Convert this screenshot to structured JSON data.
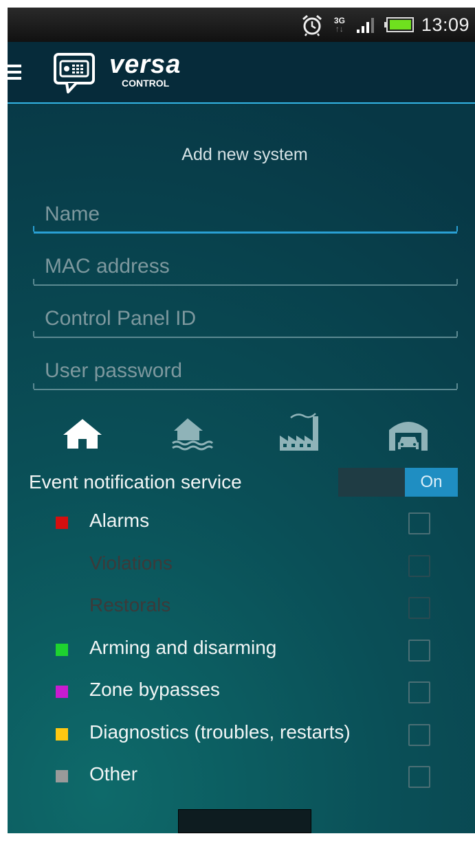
{
  "status_bar": {
    "time": "13:09",
    "network": "3G",
    "icons": [
      "alarm-clock-icon",
      "network-3g-icon",
      "signal-icon",
      "battery-icon"
    ]
  },
  "app_bar": {
    "brand_name": "VERSA",
    "brand_sub": "CONTROL"
  },
  "form": {
    "title": "Add new system",
    "fields": {
      "name_placeholder": "Name",
      "mac_placeholder": "MAC address",
      "panel_id_placeholder": "Control Panel ID",
      "password_placeholder": "User password"
    },
    "object_types": [
      "house-icon",
      "house-flood-icon",
      "factory-icon",
      "garage-icon"
    ],
    "selected_type": "house-icon"
  },
  "notifications": {
    "label": "Event notification service",
    "toggle_label": "On",
    "events": [
      {
        "label": "Alarms",
        "color": "#d40f0f",
        "enabled": true
      },
      {
        "label": "Violations",
        "color": null,
        "enabled": false
      },
      {
        "label": "Restorals",
        "color": null,
        "enabled": false
      },
      {
        "label": "Arming and disarming",
        "color": "#1ed22f",
        "enabled": true
      },
      {
        "label": "Zone bypasses",
        "color": "#c81bd0",
        "enabled": true
      },
      {
        "label": "Diagnostics (troubles, restarts)",
        "color": "#ffc812",
        "enabled": true
      },
      {
        "label": "Other",
        "color": "#9a9a9a",
        "enabled": true
      }
    ]
  },
  "colors": {
    "accent": "#33b5e5",
    "toggle_on": "#1f8ec2"
  }
}
